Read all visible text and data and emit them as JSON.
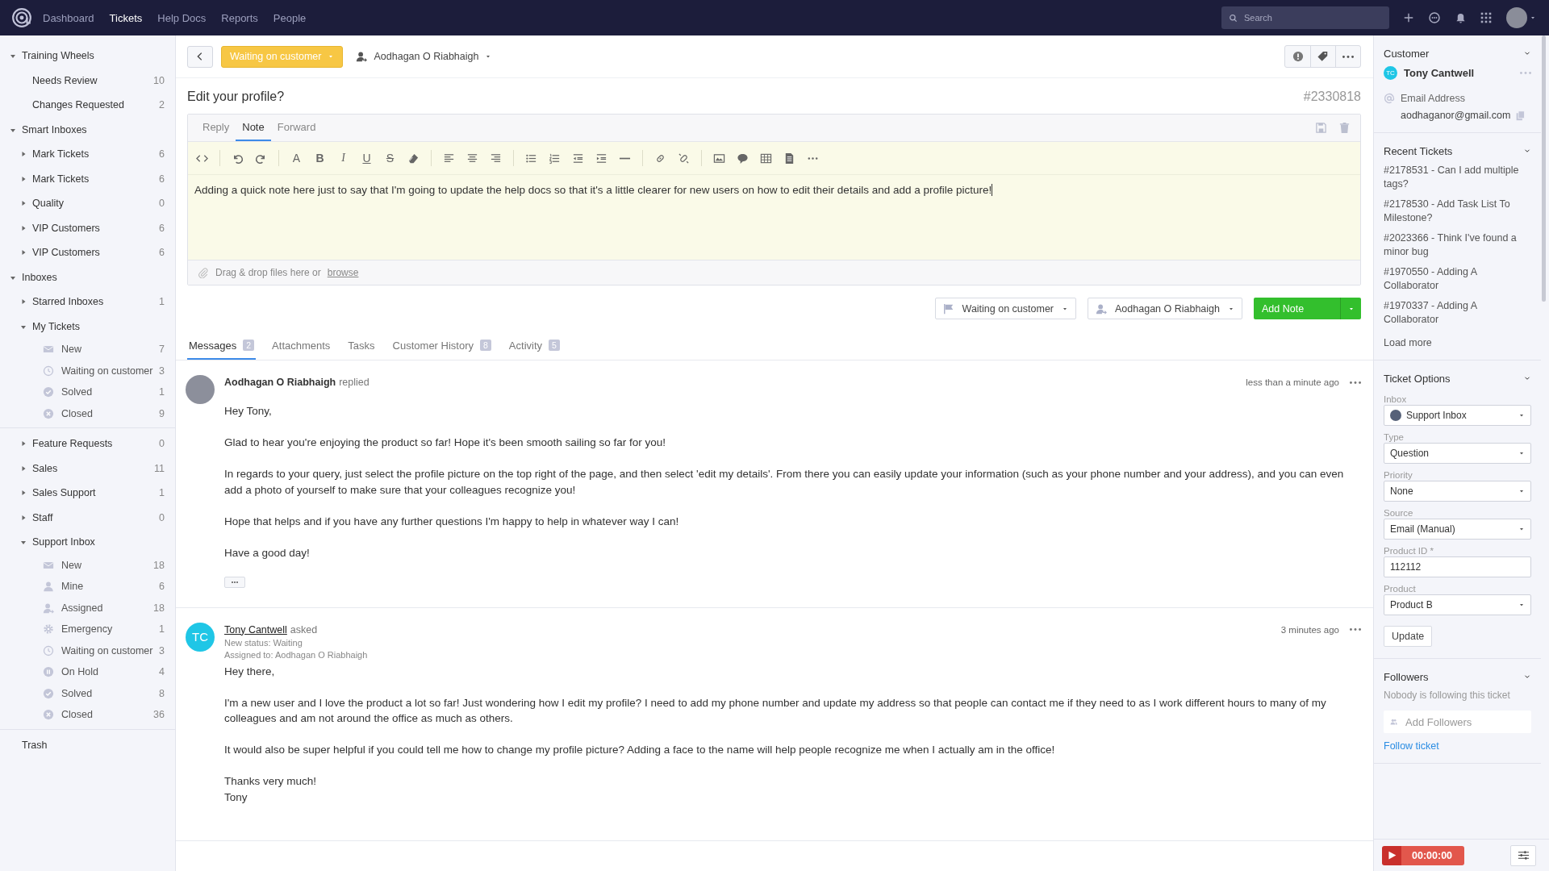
{
  "topbar": {
    "nav": [
      {
        "label": "Dashboard",
        "selected": false
      },
      {
        "label": "Tickets",
        "selected": true
      },
      {
        "label": "Help Docs",
        "selected": false
      },
      {
        "label": "Reports",
        "selected": false
      },
      {
        "label": "People",
        "selected": false
      }
    ],
    "search": {
      "placeholder": "Search"
    }
  },
  "sidebar": {
    "groups": [
      [
        {
          "label": "Training Wheels",
          "expanded": true,
          "children": [
            {
              "label": "Needs Review",
              "count": "10"
            },
            {
              "label": "Changes Requested",
              "count": "2"
            }
          ]
        },
        {
          "label": "Smart Inboxes",
          "expanded": true,
          "children": [
            {
              "label": "Mark Tickets",
              "count": "6",
              "expanded": false
            },
            {
              "label": "Mark Tickets",
              "count": "6",
              "expanded": false
            },
            {
              "label": "Quality",
              "count": "0",
              "expanded": false
            },
            {
              "label": "VIP Customers",
              "count": "6",
              "expanded": false
            },
            {
              "label": "VIP Customers",
              "count": "6",
              "expanded": false
            }
          ]
        },
        {
          "label": "Inboxes",
          "expanded": true,
          "children": [
            {
              "label": "Starred Inboxes",
              "count": "1",
              "expanded": false
            },
            {
              "label": "My Tickets",
              "expanded": true,
              "children": [
                {
                  "label": "New",
                  "count": "7",
                  "kind": "mail"
                },
                {
                  "label": "Waiting on customer",
                  "count": "3",
                  "kind": "clock"
                },
                {
                  "label": "Solved",
                  "count": "1",
                  "kind": "check"
                },
                {
                  "label": "Closed",
                  "count": "9",
                  "kind": "closed"
                }
              ]
            }
          ]
        }
      ],
      [
        {
          "label": "Feature Requests",
          "count": "0",
          "expanded": false
        },
        {
          "label": "Sales",
          "count": "11",
          "expanded": false
        },
        {
          "label": "Sales Support",
          "count": "1",
          "expanded": false
        },
        {
          "label": "Staff",
          "count": "0",
          "expanded": false
        },
        {
          "label": "Support Inbox",
          "expanded": true,
          "children": [
            {
              "label": "New",
              "count": "18",
              "kind": "mail"
            },
            {
              "label": "Mine",
              "count": "6",
              "kind": "user"
            },
            {
              "label": "Assigned",
              "count": "18",
              "kind": "assigned"
            },
            {
              "label": "Emergency",
              "count": "1",
              "kind": "gear"
            },
            {
              "label": "Waiting on customer",
              "count": "3",
              "kind": "clock"
            },
            {
              "label": "On Hold",
              "count": "4",
              "kind": "pause"
            },
            {
              "label": "Solved",
              "count": "8",
              "kind": "check"
            },
            {
              "label": "Closed",
              "count": "36",
              "kind": "closed"
            }
          ]
        }
      ],
      [
        {
          "label": "Trash"
        }
      ]
    ]
  },
  "ticket": {
    "status": "Waiting on customer",
    "assignee": "Aodhagan O Riabhaigh",
    "title": "Edit your profile?",
    "number": "#2330818",
    "composer": {
      "tabs": [
        {
          "label": "Reply",
          "selected": false
        },
        {
          "label": "Note",
          "selected": true
        },
        {
          "label": "Forward",
          "selected": false
        }
      ],
      "format_letters": [
        "A",
        "B",
        "I",
        "U",
        "S"
      ],
      "text": "Adding a quick note here just to say that I'm going to update the help docs so that it's a little clearer for new users on how to edit their details and add a profile picture!",
      "attach_text": "Drag & drop files here or",
      "attach_link": "browse"
    },
    "actions": {
      "status": "Waiting on customer",
      "assignee": "Aodhagan O Riabhaigh",
      "submit": "Add Note"
    },
    "tabs": [
      {
        "label": "Messages",
        "count": "2",
        "selected": true
      },
      {
        "label": "Attachments",
        "selected": false
      },
      {
        "label": "Tasks",
        "selected": false
      },
      {
        "label": "Customer History",
        "count": "8",
        "selected": false
      },
      {
        "label": "Activity",
        "count": "5",
        "selected": false
      }
    ],
    "messages": [
      {
        "avatar": {
          "kind": "photo"
        },
        "author": "Aodhagan O Riabhaigh",
        "author_link": false,
        "verb": "replied",
        "time": "less than a minute ago",
        "paragraphs": [
          "Hey Tony,",
          "Glad to hear you're enjoying the product so far! Hope it's been smooth sailing so far for you!",
          "In regards to your query, just select the profile picture on the top right of the page, and then select 'edit my details'. From there you can easily update your information (such as your phone number and your address), and you can even add a photo of yourself to make sure that your colleagues recognize you!",
          "Hope that helps and if you have any further questions I'm happy to help in whatever way I can!",
          "Have a good day!"
        ],
        "quoted": true
      },
      {
        "avatar": {
          "kind": "initials",
          "initials": "TC"
        },
        "author": "Tony Cantwell",
        "author_link": true,
        "verb": "asked",
        "time": "3 minutes ago",
        "meta": [
          "New status: Waiting",
          "Assigned to: Aodhagan O Riabhaigh"
        ],
        "paragraphs": [
          "Hey there,",
          "I'm a new user and I love the product a lot so far! Just wondering how I edit my profile? I need to add my phone number and update my address so that people can contact me if they need to as I work different hours to many of my colleagues and am not around the office as much as others.",
          "It would also be super helpful if you could tell me how to change my profile picture? Adding a face to the name will help people recognize me when I actually am in the office!",
          "Thanks very much!\nTony"
        ],
        "quoted": false
      }
    ]
  },
  "aside": {
    "customer": {
      "title": "Customer",
      "expanded": true,
      "initials": "TC",
      "name": "Tony Cantwell",
      "email_label": "Email Address",
      "email": "aodhaganor@gmail.com"
    },
    "recent": {
      "title": "Recent Tickets",
      "expanded": true,
      "items": [
        "#2178531 - Can I add multiple tags?",
        "#2178530 - Add Task List To Milestone?",
        "#2023366 - Think I've found a minor bug",
        "#1970550 - Adding A Collaborator",
        "#1970337 - Adding A Collaborator"
      ],
      "load_more": "Load more"
    },
    "options": {
      "title": "Ticket Options",
      "expanded": true,
      "fields": [
        {
          "label": "Inbox",
          "value": "Support Inbox",
          "kind": "inbox_select"
        },
        {
          "label": "Type",
          "value": "Question",
          "kind": "select"
        },
        {
          "label": "Priority",
          "value": "None",
          "kind": "select"
        },
        {
          "label": "Source",
          "value": "Email (Manual)",
          "kind": "select"
        },
        {
          "label": "Product ID *",
          "value": "112112",
          "kind": "input"
        },
        {
          "label": "Product",
          "value": "Product B",
          "kind": "select"
        }
      ],
      "submit": "Update"
    },
    "followers": {
      "title": "Followers",
      "expanded": true,
      "empty": "Nobody is following this ticket",
      "placeholder": "Add Followers",
      "follow": "Follow ticket"
    },
    "timer": "00:00:00"
  }
}
